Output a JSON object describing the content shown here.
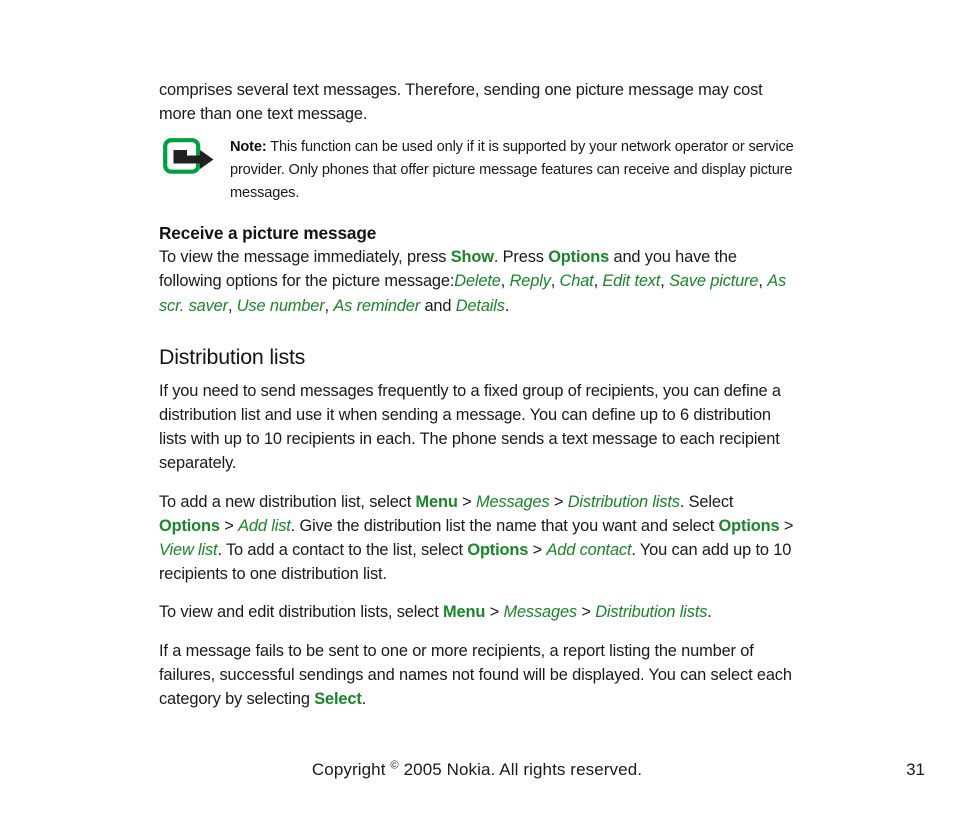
{
  "document": {
    "type": "user-guide-page",
    "page_number": "31",
    "accent_green": "#1a8529",
    "icon_green": "#00a040",
    "text_color": "#1a1a1a"
  },
  "intro_paragraph": {
    "text": "comprises several text messages. Therefore, sending one picture message may cost more than one text message."
  },
  "note": {
    "icon": "note-hand-pointer-icon",
    "label": "Note:",
    "text": " This function can be used only if it is supported by your network operator or service provider. Only phones that offer picture message features can receive and display picture messages."
  },
  "section_receive": {
    "heading": "Receive a picture message",
    "paragraph": {
      "part1": "To view the message immediately, press ",
      "cmd_show": "Show",
      "part2": ". Press ",
      "cmd_options": "Options",
      "part3": " and you have the following options for the picture message:",
      "opt_delete": "Delete",
      "sep1": ", ",
      "opt_reply": "Reply",
      "sep2": ", ",
      "opt_chat": "Chat",
      "sep3": ", ",
      "opt_edit_text": "Edit text",
      "sep4": ", ",
      "opt_save_picture": "Save picture",
      "sep5": ", ",
      "opt_as_scr_saver": "As scr. saver",
      "sep6": ", ",
      "opt_use_number": "Use number",
      "sep7": ", ",
      "opt_as_reminder": "As reminder",
      "sep8": " and ",
      "opt_details": "Details",
      "end": "."
    }
  },
  "section_distribution": {
    "heading": "Distribution lists",
    "paragraph1": "If you need to send messages frequently to a fixed group of recipients, you can define a distribution list and use it when sending a message. You can define up to 6 distribution lists with up to 10 recipients in each. The phone sends a text message to each recipient separately.",
    "paragraph2": {
      "p1": "To add a new distribution list, select ",
      "menu": "Menu",
      "gt1": " > ",
      "messages": "Messages",
      "gt2": " > ",
      "distribution_lists": "Distribution lists",
      "p2": ". Select ",
      "options1": "Options",
      "gt3": " > ",
      "add_list": "Add list",
      "p3": ". Give the distribution list the name that you want and select ",
      "options2": "Options",
      "gt4": " > ",
      "view_list": "View list",
      "p4": ". To add a contact to the list, select ",
      "options3": "Options",
      "gt5": " > ",
      "add_contact": "Add contact",
      "p5": ". You can add up to 10 recipients to one distribution list."
    },
    "paragraph3": {
      "p1": "To view and edit distribution lists, select ",
      "menu": "Menu",
      "gt1": " > ",
      "messages": "Messages",
      "gt2": " > ",
      "distribution_lists": "Distribution lists",
      "p2": "."
    },
    "paragraph4": {
      "p1": "If a message fails to be sent to one or more recipients, a report listing the number of failures, successful sendings and names not found will be displayed. You can select each category by selecting ",
      "select": "Select",
      "p2": "."
    }
  },
  "footer": {
    "copyright_prefix": "Copyright ",
    "copyright_symbol": "©",
    "copyright_rest": " 2005 Nokia. All rights reserved.",
    "page_number": "31"
  }
}
